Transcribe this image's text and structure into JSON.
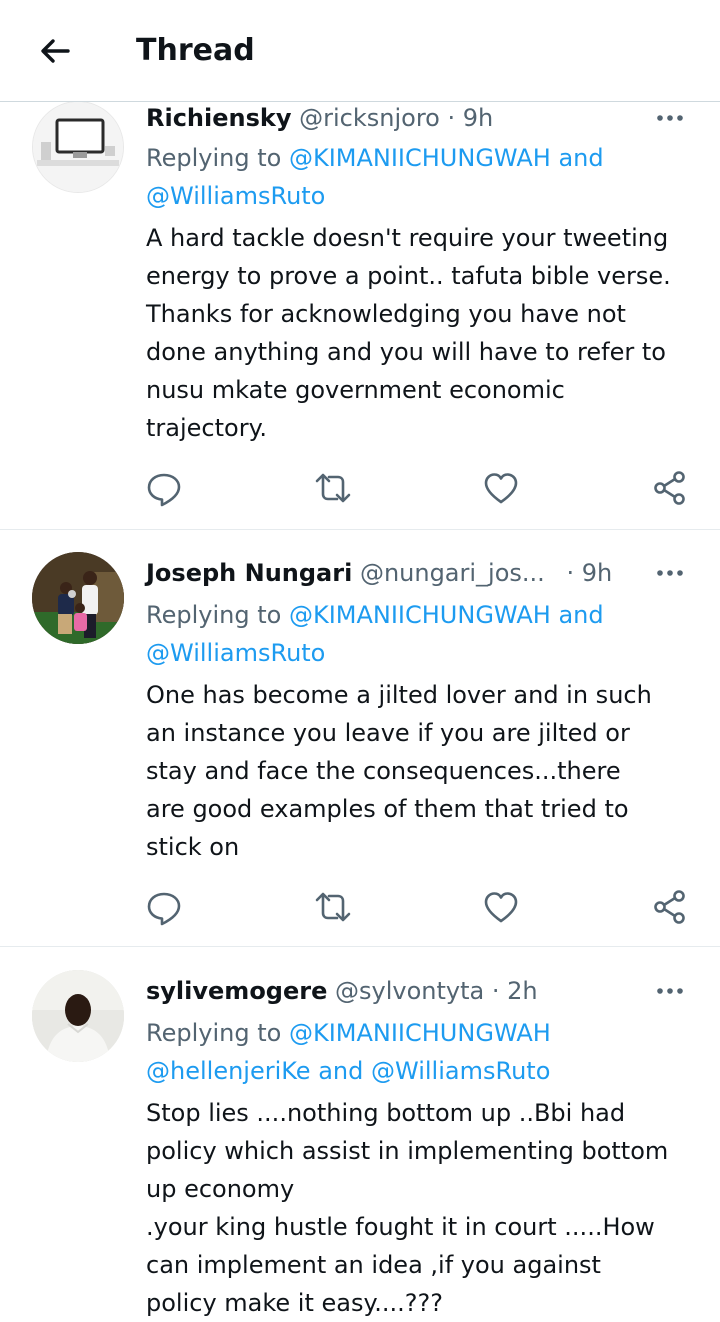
{
  "header": {
    "title": "Thread",
    "back_icon": "arrow-left-icon"
  },
  "tweets": [
    {
      "name": "Richiensky",
      "handle": "@ricksnjoro",
      "separator": "·",
      "time": "9h",
      "reply_prefix": "Replying to",
      "reply_line1": "@KIMANIICHUNGWAH and",
      "reply_line2": "@WilliamsRuto",
      "text_lines": [
        "A hard tackle doesn't require your tweeting",
        "energy to prove a point.. tafuta bible verse.",
        "Thanks for acknowledging you have not",
        "done anything and you will have to refer to",
        "nusu mkate government economic",
        "trajectory."
      ]
    },
    {
      "name": "Joseph Nungari",
      "handle": "@nungari_jos...",
      "separator": "·",
      "time": "9h",
      "reply_prefix": "Replying to",
      "reply_line1": "@KIMANIICHUNGWAH and",
      "reply_line2": "@WilliamsRuto",
      "text_lines": [
        "One has become a jilted lover and in such",
        "an instance you leave if you are jilted or",
        "stay and face the consequences...there",
        "are good examples of them that tried to",
        "stick on"
      ]
    },
    {
      "name": "sylivemogere",
      "handle": "@sylvontyta",
      "separator": "·",
      "time": "2h",
      "reply_prefix": "Replying to",
      "reply_line1": "@KIMANIICHUNGWAH",
      "reply_line2_a": "@hellenjeriKe",
      "reply_line2_b": "and",
      "reply_line2_c": "@WilliamsRuto",
      "text_lines": [
        "Stop lies ....nothing bottom up ..Bbi had",
        "policy which assist in implementing bottom",
        "up economy",
        ".your king hustle fought it in court .....How",
        "can implement an idea ,if you against",
        "policy make it easy....???"
      ]
    }
  ],
  "icons": {
    "reply": "reply-icon",
    "retweet": "retweet-icon",
    "like": "like-icon",
    "share": "share-icon",
    "more": "more-icon"
  },
  "colors": {
    "text": "#0f1419",
    "secondary": "#536471",
    "link": "#1d9bf0",
    "divider": "#e6ebee"
  }
}
